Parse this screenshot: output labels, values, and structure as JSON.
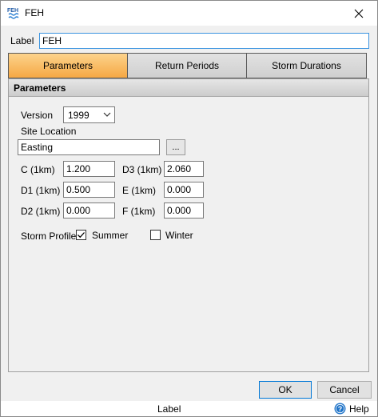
{
  "window": {
    "icon_text_top": "FEH",
    "title": "FEH",
    "close_glyph": "✕"
  },
  "label_row": {
    "label": "Label",
    "value": "FEH"
  },
  "tabs": [
    {
      "label": "Parameters",
      "active": true
    },
    {
      "label": "Return Periods",
      "active": false
    },
    {
      "label": "Storm Durations",
      "active": false
    }
  ],
  "panel": {
    "header": "Parameters",
    "version": {
      "label": "Version",
      "selected": "1999"
    },
    "site_location": {
      "label": "Site Location",
      "value": "Easting",
      "browse_label": "..."
    },
    "params": {
      "c": {
        "label": "C (1km)",
        "value": "1.200"
      },
      "d3": {
        "label": "D3 (1km)",
        "value": "2.060"
      },
      "d1": {
        "label": "D1 (1km)",
        "value": "0.500"
      },
      "e": {
        "label": "E (1km)",
        "value": "0.000"
      },
      "d2": {
        "label": "D2 (1km)",
        "value": "0.000"
      },
      "f": {
        "label": "F (1km)",
        "value": "0.000"
      }
    },
    "storm_profile": {
      "label": "Storm Profile",
      "summer": {
        "label": "Summer",
        "checked": true
      },
      "winter": {
        "label": "Winter",
        "checked": false
      }
    }
  },
  "buttons": {
    "ok": "OK",
    "cancel": "Cancel"
  },
  "statusbar": {
    "label": "Label",
    "help": "Help"
  },
  "colors": {
    "active_tab": "#f6a844",
    "input_focus_border": "#3c94e0",
    "help_icon": "#1e73c8"
  },
  "icons": {
    "app": "feh-app-icon",
    "close": "close-icon",
    "dropdown": "chevron-down-icon",
    "check": "checkmark-icon",
    "help": "help-icon"
  }
}
